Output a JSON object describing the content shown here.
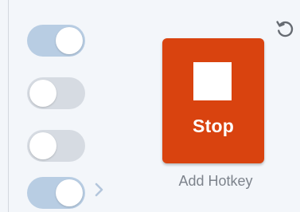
{
  "toggles": [
    {
      "state": "on"
    },
    {
      "state": "off"
    },
    {
      "state": "off"
    },
    {
      "state": "on"
    }
  ],
  "stop_button": {
    "label": "Stop",
    "color": "#d9430f",
    "icon": "stop-square-icon"
  },
  "hotkey": {
    "label": "Add Hotkey"
  },
  "icons": {
    "reset": "rotate-ccw-icon",
    "expand": "chevron-right-icon"
  },
  "colors": {
    "toggle_on": "#b8cde3",
    "toggle_off": "#d6dbe2",
    "background": "#f3f6fa"
  }
}
